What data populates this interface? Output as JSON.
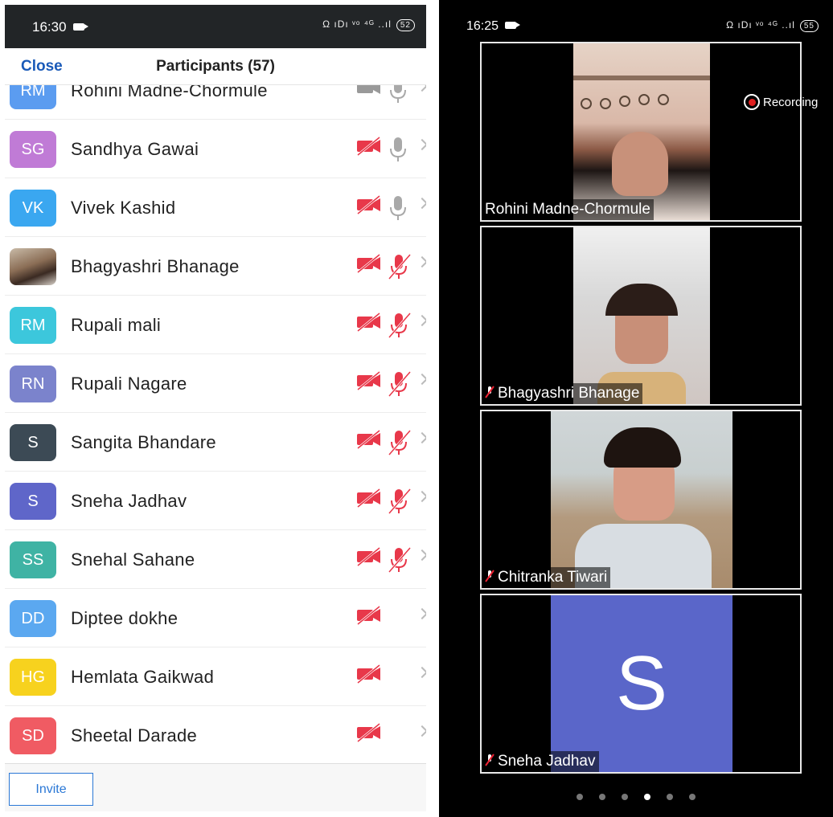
{
  "left_status": {
    "time": "16:30",
    "icons": "Ω ıDı ᵛᵒ ⁴ᴳ ..ıl",
    "battery": "52"
  },
  "right_status": {
    "time": "16:25",
    "icons": "Ω ıDı ᵛᵒ ⁴ᴳ ..ıl",
    "battery": "55"
  },
  "header": {
    "close_label": "Close",
    "title": "Participants (57)"
  },
  "participants": [
    {
      "initials": "RM",
      "name": "Rohini Madne-Chormule",
      "color": "#5b9cf0",
      "cam": "grey",
      "mic": "grey"
    },
    {
      "initials": "SG",
      "name": "Sandhya Gawai",
      "color": "#c07bd6",
      "cam": "off",
      "mic": "on"
    },
    {
      "initials": "VK",
      "name": "Vivek Kashid",
      "color": "#3aa7f0",
      "cam": "off",
      "mic": "on"
    },
    {
      "initials": "",
      "name": "Bhagyashri Bhanage",
      "color": "",
      "cam": "off",
      "mic": "off"
    },
    {
      "initials": "RM",
      "name": "Rupali mali",
      "color": "#3cc7dc",
      "cam": "off",
      "mic": "off"
    },
    {
      "initials": "RN",
      "name": "Rupali Nagare",
      "color": "#7b83cc",
      "cam": "off",
      "mic": "off"
    },
    {
      "initials": "S",
      "name": "Sangita Bhandare",
      "color": "#3c4a55",
      "cam": "off",
      "mic": "off"
    },
    {
      "initials": "S",
      "name": "Sneha Jadhav",
      "color": "#5f66c9",
      "cam": "off",
      "mic": "off"
    },
    {
      "initials": "SS",
      "name": "Snehal Sahane",
      "color": "#3fb3a4",
      "cam": "off",
      "mic": "off"
    },
    {
      "initials": "DD",
      "name": "Diptee dokhe",
      "color": "#5ba8f0",
      "cam": "off",
      "mic": "none"
    },
    {
      "initials": "HG",
      "name": "Hemlata Gaikwad",
      "color": "#f7d21e",
      "cam": "off",
      "mic": "none"
    },
    {
      "initials": "SD",
      "name": "Sheetal Darade",
      "color": "#f05b63",
      "cam": "off",
      "mic": "none"
    }
  ],
  "footer": {
    "invite_label": "Invite"
  },
  "recording_label": "Recording",
  "tiles": [
    {
      "name": "Rohini Madne-Chormule",
      "muted": false,
      "kind": "video1"
    },
    {
      "name": "Bhagyashri Bhanage",
      "muted": true,
      "kind": "video2"
    },
    {
      "name": "Chitranka Tiwari",
      "muted": true,
      "kind": "video3"
    },
    {
      "name": "Sneha Jadhav",
      "muted": true,
      "kind": "avatar",
      "avatar_letter": "S",
      "avatar_color": "#5a66c9"
    }
  ],
  "page_dots": {
    "count": 6,
    "active": 3
  }
}
